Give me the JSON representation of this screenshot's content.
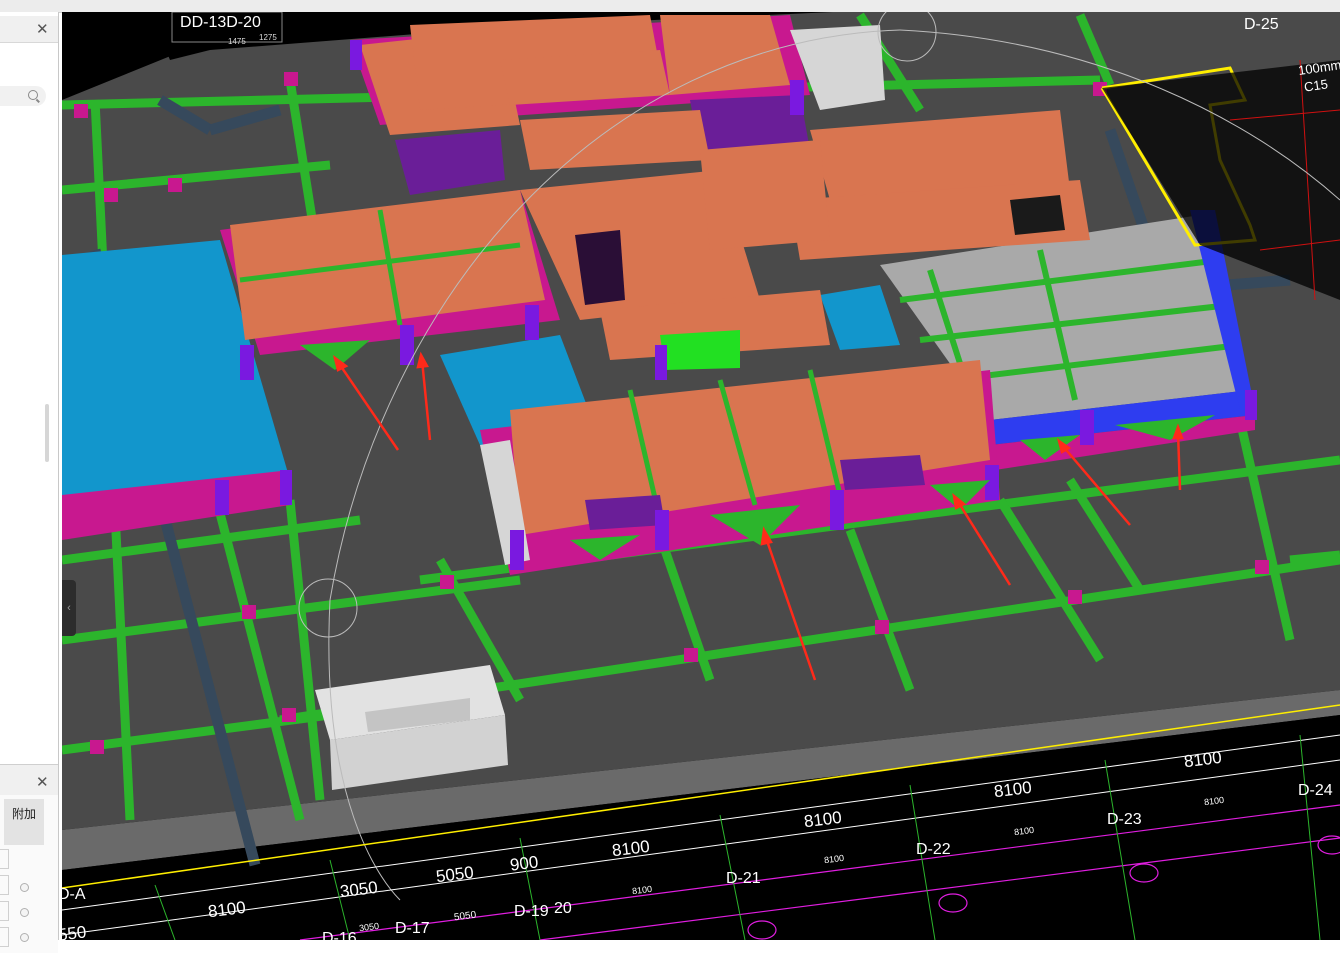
{
  "left_panel": {
    "close_icon": "close-icon",
    "search_icon": "search-icon",
    "collapse_icon": "chevron-left-icon",
    "collapse_glyph": "‹"
  },
  "property_panel": {
    "close_icon": "close-icon",
    "tab_label": "附加"
  },
  "axis_labels": {
    "top_left": "D-13",
    "top_left_prefix": "D",
    "top_left_2": "D-20",
    "top_right": "D-25",
    "bottom_left": "D-A",
    "grid_lines": [
      "D-16",
      "D-17",
      "D-19",
      "20",
      "D-21",
      "D-22",
      "D-23",
      "D-24"
    ]
  },
  "dimensions": {
    "outer": [
      "8100",
      "3050",
      "5050",
      "900",
      "8100",
      "8100",
      "8100",
      "8100",
      "8100"
    ],
    "inner": [
      "3050",
      "5050",
      "8100",
      "8100",
      "8100",
      "8100"
    ],
    "partial_left": "550",
    "small_top": [
      "1475",
      "1275"
    ]
  },
  "annotation_right": {
    "line1": "100mm",
    "line2": "C15"
  },
  "colors": {
    "slab_orange": "#d97550",
    "beam_green": "#2cb52c",
    "column_purple": "#7a19e0",
    "wall_magenta": "#c8188f",
    "blue_beam": "#2e3df0",
    "cyan_slab": "#1296cc",
    "gray_slab": "#a9a9a9",
    "floor_dark": "#4a4a4a",
    "yellow_outline": "#ffee00",
    "red_arrow": "#ff2a1a"
  }
}
